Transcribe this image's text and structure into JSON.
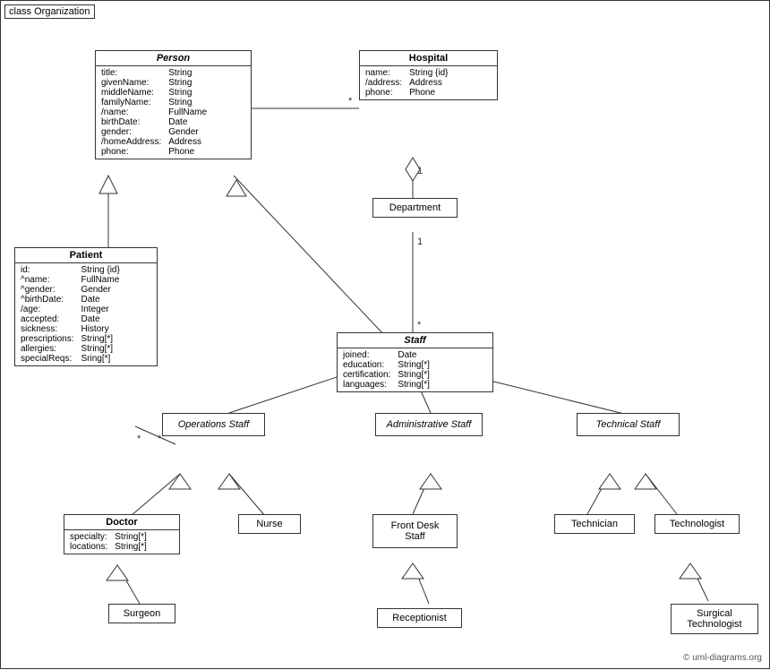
{
  "diagram": {
    "title": "class Organization",
    "copyright": "© uml-diagrams.org",
    "classes": {
      "person": {
        "name": "Person",
        "italic": true,
        "attributes": [
          {
            "name": "title:",
            "type": "String"
          },
          {
            "name": "givenName:",
            "type": "String"
          },
          {
            "name": "middleName:",
            "type": "String"
          },
          {
            "name": "familyName:",
            "type": "String"
          },
          {
            "name": "/name:",
            "type": "FullName"
          },
          {
            "name": "birthDate:",
            "type": "Date"
          },
          {
            "name": "gender:",
            "type": "Gender"
          },
          {
            "name": "/homeAddress:",
            "type": "Address"
          },
          {
            "name": "phone:",
            "type": "Phone"
          }
        ]
      },
      "hospital": {
        "name": "Hospital",
        "attributes": [
          {
            "name": "name:",
            "type": "String {id}"
          },
          {
            "name": "/address:",
            "type": "Address"
          },
          {
            "name": "phone:",
            "type": "Phone"
          }
        ]
      },
      "patient": {
        "name": "Patient",
        "attributes": [
          {
            "name": "id:",
            "type": "String {id}"
          },
          {
            "name": "^name:",
            "type": "FullName"
          },
          {
            "name": "^gender:",
            "type": "Gender"
          },
          {
            "name": "^birthDate:",
            "type": "Date"
          },
          {
            "name": "/age:",
            "type": "Integer"
          },
          {
            "name": "accepted:",
            "type": "Date"
          },
          {
            "name": "sickness:",
            "type": "History"
          },
          {
            "name": "prescriptions:",
            "type": "String[*]"
          },
          {
            "name": "allergies:",
            "type": "String[*]"
          },
          {
            "name": "specialReqs:",
            "type": "Sring[*]"
          }
        ]
      },
      "department": {
        "name": "Department"
      },
      "staff": {
        "name": "Staff",
        "italic": true,
        "attributes": [
          {
            "name": "joined:",
            "type": "Date"
          },
          {
            "name": "education:",
            "type": "String[*]"
          },
          {
            "name": "certification:",
            "type": "String[*]"
          },
          {
            "name": "languages:",
            "type": "String[*]"
          }
        ]
      },
      "operations_staff": {
        "name": "Operations Staff",
        "italic": true
      },
      "administrative_staff": {
        "name": "Administrative Staff",
        "italic": true
      },
      "technical_staff": {
        "name": "Technical Staff",
        "italic": true
      },
      "doctor": {
        "name": "Doctor",
        "attributes": [
          {
            "name": "specialty:",
            "type": "String[*]"
          },
          {
            "name": "locations:",
            "type": "String[*]"
          }
        ]
      },
      "nurse": {
        "name": "Nurse"
      },
      "front_desk_staff": {
        "name": "Front Desk Staff"
      },
      "technician": {
        "name": "Technician"
      },
      "technologist": {
        "name": "Technologist"
      },
      "surgeon": {
        "name": "Surgeon"
      },
      "receptionist": {
        "name": "Receptionist"
      },
      "surgical_technologist": {
        "name": "Surgical Technologist"
      }
    }
  }
}
